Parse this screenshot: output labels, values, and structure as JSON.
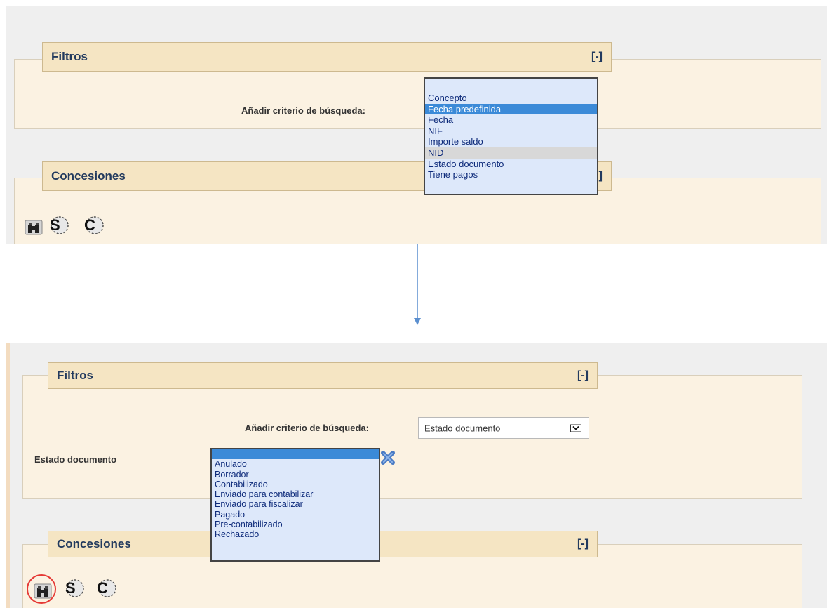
{
  "top_panel": {
    "filtros_tab": {
      "title": "Filtros",
      "toggle": "[-]"
    },
    "criteria_label": "Añadir criterio de búsqueda:",
    "criteria_dropdown_options": [
      "",
      "Concepto",
      "Fecha predefinida",
      "Fecha",
      "NIF",
      "Importe saldo",
      "NID",
      "Estado documento",
      "Tiene pagos"
    ],
    "criteria_dropdown_selected": "Fecha predefinida",
    "criteria_dropdown_hovered": "NID",
    "concesiones_tab": {
      "title": "Concesiones",
      "toggle": "]"
    },
    "toolbar_icons": [
      "binoculars-icon",
      "s-icon",
      "c-icon"
    ]
  },
  "bottom_panel": {
    "filtros_tab": {
      "title": "Filtros",
      "toggle": "[-]"
    },
    "criteria_label": "Añadir criterio de búsqueda:",
    "criteria_select_value": "Estado documento",
    "estado_label": "Estado documento",
    "estado_dropdown_options": [
      "",
      "Anulado",
      "Borrador",
      "Contabilizado",
      "Enviado para contabilizar",
      "Enviado para fiscalizar",
      "Pagado",
      "Pre-contabilizado",
      "Rechazado"
    ],
    "estado_dropdown_selected": "",
    "concesiones_tab": {
      "title": "Concesiones",
      "toggle": "[-]"
    },
    "toolbar_icons": [
      "binoculars-icon",
      "s-icon",
      "c-icon"
    ]
  },
  "colors": {
    "panel_bg": "#fbf2e2",
    "tab_bg": "#f5e5c3",
    "tab_text": "#223a5e",
    "listbox_bg": "#dde8fa",
    "selection": "#3b8ad8",
    "arrow": "#5b8fcf",
    "highlight_circle": "#e53935"
  }
}
